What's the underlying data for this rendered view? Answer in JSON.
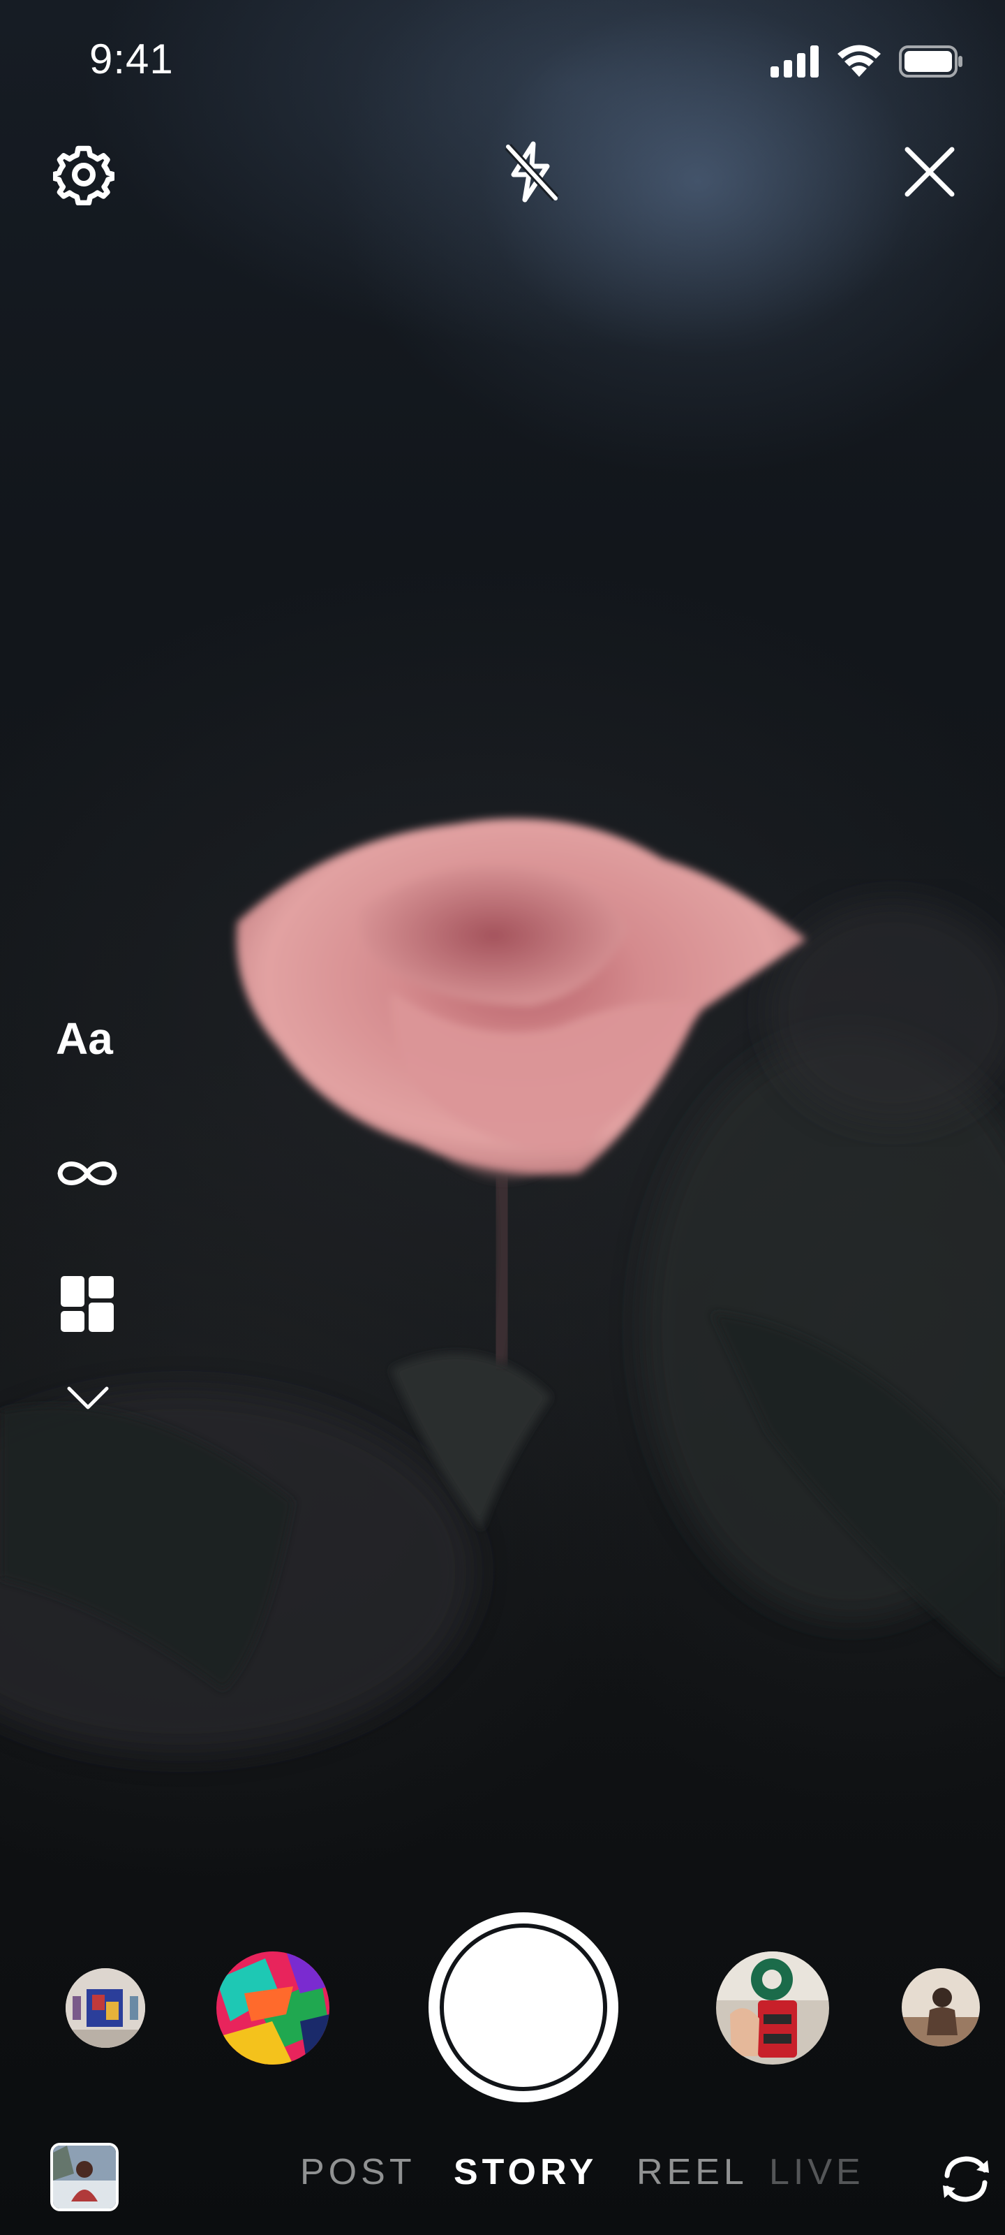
{
  "status_bar": {
    "time": "9:41",
    "icons": [
      "signal-icon",
      "wifi-icon",
      "battery-icon"
    ]
  },
  "top_bar": {
    "settings_icon": "gear-icon",
    "flash_icon": "flash-off-icon",
    "close_icon": "close-icon"
  },
  "side_tools": {
    "create_label": "Aa",
    "boomerang_icon": "infinity-icon",
    "layout_icon": "layout-grid-icon",
    "more_icon": "chevron-down-icon"
  },
  "capture": {
    "shutter_icon": "shutter-button"
  },
  "effects": [
    {
      "name": "effect-art-gallery"
    },
    {
      "name": "effect-abstract-colors"
    },
    {
      "name": "effect-starbucks-cup"
    },
    {
      "name": "effect-person-sitting"
    }
  ],
  "modes": {
    "items": [
      "POST",
      "STORY",
      "REEL",
      "LIVE"
    ],
    "active": "STORY"
  },
  "bottom_bar": {
    "gallery_icon": "gallery-thumbnail",
    "flip_icon": "flip-camera-icon"
  },
  "colors": {
    "foreground": "#ffffff",
    "background": "#0c0f12",
    "rose": "#d98a8c"
  }
}
